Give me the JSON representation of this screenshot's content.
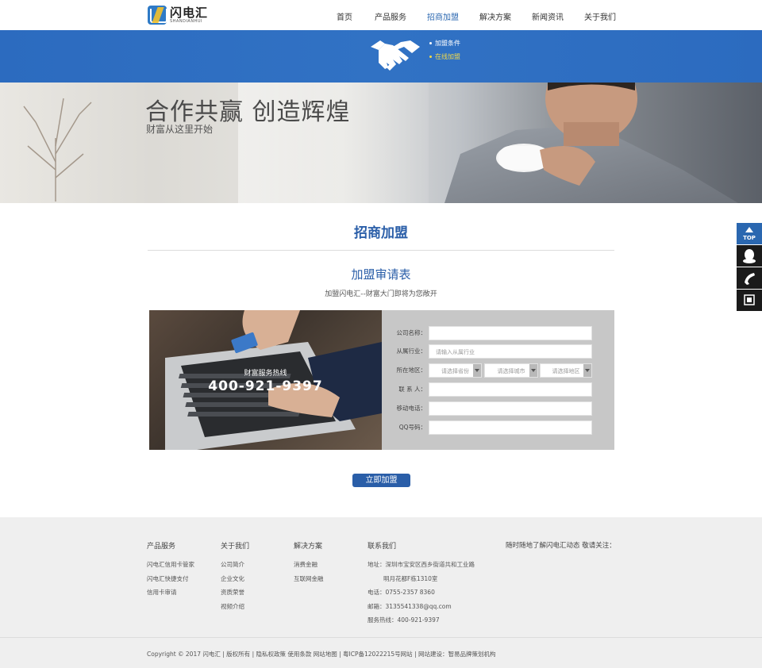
{
  "header": {
    "logo_cn": "闪电汇",
    "logo_en": "SHANDIANHUI",
    "nav": [
      {
        "label": "首页",
        "active": false
      },
      {
        "label": "产品服务",
        "active": false
      },
      {
        "label": "招商加盟",
        "active": true
      },
      {
        "label": "解决方案",
        "active": false
      },
      {
        "label": "新闻资讯",
        "active": false
      },
      {
        "label": "关于我们",
        "active": false
      }
    ]
  },
  "band": {
    "icon": "handshake-icon",
    "links": [
      {
        "label": "加盟条件",
        "active": false
      },
      {
        "label": "在线加盟",
        "active": true
      }
    ]
  },
  "hero": {
    "title": "合作共赢 创造辉煌",
    "subtitle": "财富从这里开始"
  },
  "section": {
    "title": "招商加盟",
    "form_title": "加盟审请表",
    "form_subtitle": "加盟闪电汇--财富大门即将为您敞开"
  },
  "form": {
    "hotline_label": "财富服务热线",
    "hotline_number": "400-921-9397",
    "fields": {
      "company": {
        "label": "公司名称：",
        "value": "",
        "placeholder": ""
      },
      "industry": {
        "label": "从属行业：",
        "value": "",
        "placeholder": "请输入从属行业"
      },
      "region": {
        "label": "所在地区：",
        "province": "请选择省份",
        "city": "请选择城市",
        "district": "请选择地区"
      },
      "contact": {
        "label": "联 系 人：",
        "value": ""
      },
      "mobile": {
        "label": "移动电话：",
        "value": ""
      },
      "qq": {
        "label": "QQ号码：",
        "value": ""
      }
    },
    "submit_label": "立即加盟"
  },
  "float_bar": {
    "top_label": "TOP",
    "items": [
      "qq-icon",
      "phone-icon",
      "qrcode-icon"
    ]
  },
  "footer": {
    "columns": [
      {
        "heading": "产品服务",
        "links": [
          "闪电汇信用卡管家",
          "闪电汇快捷支付",
          "信用卡审请"
        ]
      },
      {
        "heading": "关于我们",
        "links": [
          "公司简介",
          "企业文化",
          "资质荣誉",
          "视频介绍"
        ]
      },
      {
        "heading": "解决方案",
        "links": [
          "消费金融",
          "互联网金融"
        ]
      },
      {
        "heading": "联系我们",
        "links": [
          "地址：深圳市宝安区西乡街道共和工业路",
          "明月花都F栋1310室",
          "电话：0755-2357 8360",
          "邮箱：3135541338@qq.com",
          "服务热线：400-921-9397"
        ]
      }
    ],
    "follow_text": "随时随地了解闪电汇动态 敬请关注：",
    "copyright": "Copyright © 2017 闪电汇    |    版权所有    |    隐私权政策  使用条款  网站地图    |    粤ICP备12022215号网站    |    网站建设：智易品牌策划机构"
  },
  "colors": {
    "brand_blue": "#2a5ea8",
    "band_blue": "#2c6bbf",
    "active_link": "#f2d94a"
  }
}
